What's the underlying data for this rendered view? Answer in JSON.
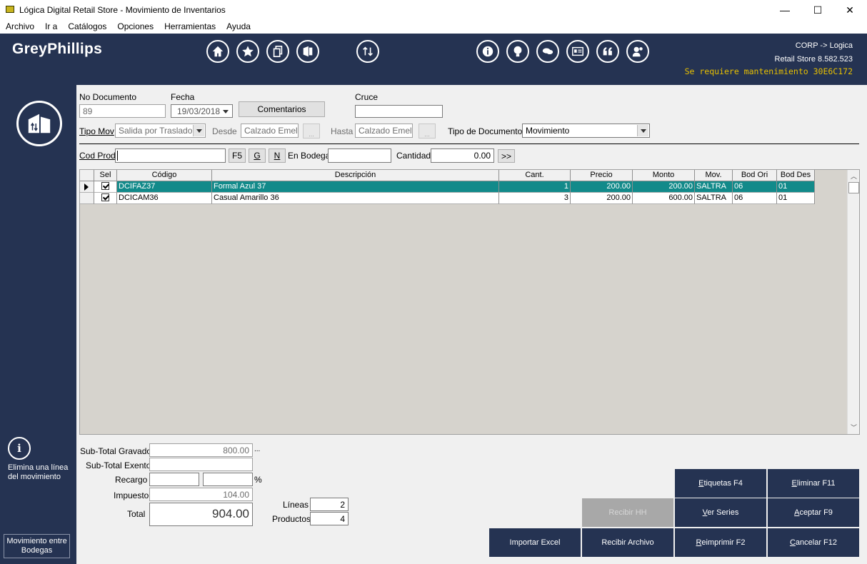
{
  "window": {
    "title": "Lógica Digital Retail Store - Movimiento de Inventarios",
    "minimize": "—",
    "maximize": "☐",
    "close": "✕"
  },
  "menu": [
    "Archivo",
    "Ir a",
    "Catálogos",
    "Opciones",
    "Herramientas",
    "Ayuda"
  ],
  "header": {
    "brand": "GreyPhillips",
    "corp_line1": "CORP -> Logica",
    "corp_line2": "Retail Store 8.582.523",
    "maintenance": "Se requiere mantenimiento 30E6C172",
    "toolbar_icons": [
      "home-icon",
      "star-icon",
      "copy-icon",
      "office-icon",
      "sort-arrows-icon",
      "info-icon",
      "lightbulb-icon",
      "chat-icon",
      "id-card-icon",
      "quote-icon",
      "support-icon"
    ]
  },
  "sidebar": {
    "info_glyph": "i",
    "hint": "Elimina una línea del movimiento",
    "module": "Movimiento entre Bodegas"
  },
  "form": {
    "no_documento_label": "No Documento",
    "no_documento": "89",
    "fecha_label": "Fecha",
    "fecha": "19/03/2018",
    "comentarios": "Comentarios",
    "cruce_label": "Cruce",
    "cruce": "",
    "tipo_mov_label": "Tipo Mov",
    "tipo_mov": "Salida por Traslado",
    "desde_label": "Desde",
    "desde": "Calzado Emely E",
    "hasta_label": "Hasta",
    "hasta": "Calzado Emely S",
    "ellipsis": "...",
    "tipo_documento_label": "Tipo de Documento",
    "tipo_documento": "Movimiento",
    "cod_prod_label": "Cod Prod",
    "cod_prod": "",
    "f5": "F5",
    "g": "G",
    "n": "N",
    "en_bodega_label": "En Bodega",
    "en_bodega": "",
    "cantidad_label": "Cantidad",
    "cantidad": "0.00",
    "next": ">>"
  },
  "grid": {
    "columns": [
      "Sel",
      "Código",
      "Descripción",
      "Cant.",
      "Precio",
      "Monto",
      "Mov.",
      "Bod Ori",
      "Bod Des"
    ],
    "rows": [
      {
        "codigo": "DCIFAZ37",
        "descripcion": "Formal Azul 37",
        "cant": "1",
        "precio": "200.00",
        "monto": "200.00",
        "mov": "SALTRA",
        "bod_ori": "06",
        "bod_des": "01"
      },
      {
        "codigo": "DCICAM36",
        "descripcion": "Casual Amarillo 36",
        "cant": "3",
        "precio": "200.00",
        "monto": "600.00",
        "mov": "SALTRA",
        "bod_ori": "06",
        "bod_des": "01"
      }
    ]
  },
  "totals": {
    "subtotal_gravado_label": "Sub-Total Gravado",
    "subtotal_gravado": "800.00",
    "subtotal_gravado_more": "...",
    "subtotal_exento_label": "Sub-Total Exento",
    "subtotal_exento": "",
    "recargo_label": "Recargo",
    "recargo_amount": "",
    "recargo_pct": "",
    "pct_sign": "%",
    "impuesto_label": "Impuesto",
    "impuesto": "104.00",
    "total_label": "Total",
    "total": "904.00",
    "lineas_label": "Líneas",
    "lineas": "2",
    "productos_label": "Productos",
    "productos": "4"
  },
  "actions": {
    "etiquetas": "Etiquetas F4",
    "eliminar": "Eliminar F11",
    "recibir_hh": "Recibir HH",
    "ver_series": "Ver Series",
    "aceptar": "Aceptar F9",
    "importar_excel": "Importar Excel",
    "recibir_archivo": "Recibir Archivo",
    "reimprimir": "Reimprimir F2",
    "cancelar": "Cancelar F12"
  }
}
